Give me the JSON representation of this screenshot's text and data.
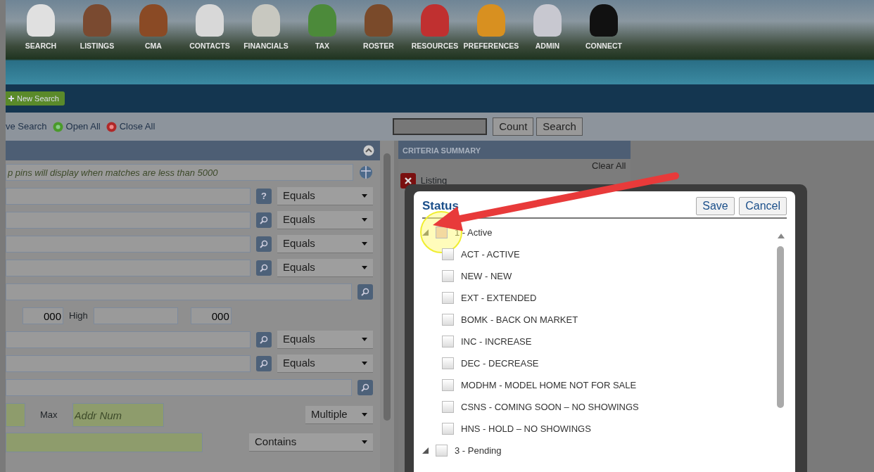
{
  "nav": [
    {
      "label": "SEARCH"
    },
    {
      "label": "LISTINGS"
    },
    {
      "label": "CMA"
    },
    {
      "label": "CONTACTS"
    },
    {
      "label": "FINANCIALS"
    },
    {
      "label": "TAX"
    },
    {
      "label": "ROSTER"
    },
    {
      "label": "RESOURCES"
    },
    {
      "label": "PREFERENCES"
    },
    {
      "label": "ADMIN"
    },
    {
      "label": "CONNECT"
    }
  ],
  "new_search": "New Search",
  "toolbar": {
    "save_search": "ve Search",
    "open_all": "Open All",
    "close_all": "Close All",
    "count": "Count",
    "search": "Search"
  },
  "search_panel": {
    "hint": "p pins will display when matches are less than 5000",
    "rows": [
      {
        "kind": "operator",
        "help": "?",
        "operator": "Equals"
      },
      {
        "kind": "operator",
        "operator": "Equals"
      },
      {
        "kind": "operator",
        "operator": "Equals"
      },
      {
        "kind": "operator",
        "operator": "Equals"
      },
      {
        "kind": "wide"
      },
      {
        "kind": "range",
        "low": "000",
        "label": "High",
        "high": "000"
      },
      {
        "kind": "operator",
        "operator": "Equals"
      },
      {
        "kind": "operator",
        "operator": "Equals"
      },
      {
        "kind": "wide"
      },
      {
        "kind": "minmax",
        "label": "Max",
        "placeholder": "Addr Num",
        "operator": "Multiple"
      },
      {
        "kind": "contains",
        "operator": "Contains"
      }
    ]
  },
  "criteria": {
    "title": "CRITERIA SUMMARY",
    "clear": "Clear All",
    "items": [
      {
        "label": "Listing"
      }
    ]
  },
  "dialog": {
    "title": "Status",
    "buttons": [
      "Save",
      "Cancel"
    ],
    "tree": [
      {
        "label": "1 - Active",
        "expanded": true,
        "checked": false,
        "highlighted": true,
        "children": [
          {
            "label": "ACT - ACTIVE",
            "checked": false,
            "highlighted": false
          },
          {
            "label": "NEW - NEW",
            "checked": false,
            "highlighted": false
          },
          {
            "label": "EXT - EXTENDED",
            "checked": false,
            "highlighted": false
          },
          {
            "label": "BOMK - BACK ON MARKET",
            "checked": false,
            "highlighted": false
          },
          {
            "label": "INC - INCREASE",
            "checked": false,
            "highlighted": false
          },
          {
            "label": "DEC - DECREASE",
            "checked": false,
            "highlighted": false
          },
          {
            "label": "MODHM - MODEL HOME NOT FOR SALE",
            "checked": false,
            "highlighted": false
          },
          {
            "label": "CSNS - COMING SOON – NO SHOWINGS",
            "checked": false,
            "highlighted": false
          },
          {
            "label": "HNS - HOLD – NO SHOWINGS",
            "checked": false,
            "highlighted": false
          }
        ]
      },
      {
        "label": "3 - Pending",
        "expanded": true,
        "checked": false,
        "highlighted": false
      }
    ]
  }
}
